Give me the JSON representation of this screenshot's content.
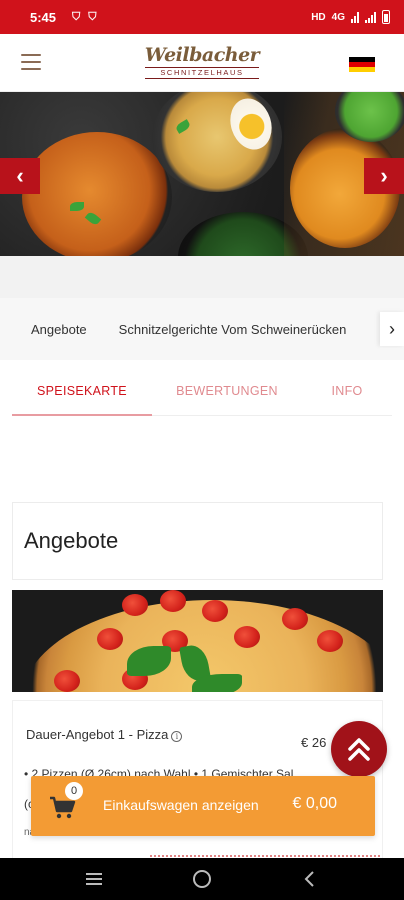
{
  "status_bar": {
    "time": "5:45",
    "network": "4G"
  },
  "header": {
    "logo_script": "Weilbacher",
    "logo_sub": "SCHNITZELHAUS",
    "language_flag": "germany-flag-icon"
  },
  "slider": {
    "prev_icon": "‹",
    "next_icon": "›"
  },
  "categories": {
    "items": [
      "Angebote",
      "Schnitzelgerichte Vom Schweinerücken"
    ],
    "next_icon": "›"
  },
  "tabs": [
    {
      "label": "SPEISEKARTE",
      "active": true
    },
    {
      "label": "BEWERTUNGEN",
      "active": false
    },
    {
      "label": "INFO",
      "active": false
    }
  ],
  "section": {
    "title": "Angebote"
  },
  "product": {
    "name": "Dauer-Angebot 1 - Pizza",
    "price": "€ 26",
    "description": "• 2 Pizzen (Ø 26cm) nach Wahl • 1 Gemischter Sal",
    "description2": "(c",
    "note": "nach Wahl"
  },
  "cart": {
    "count": "0",
    "label": "Einkaufswagen anzeigen",
    "total": "€ 0,00"
  },
  "colors": {
    "brand_red": "#d0121b",
    "accent_orange": "#f39b34",
    "scroll_top": "#a11219"
  }
}
